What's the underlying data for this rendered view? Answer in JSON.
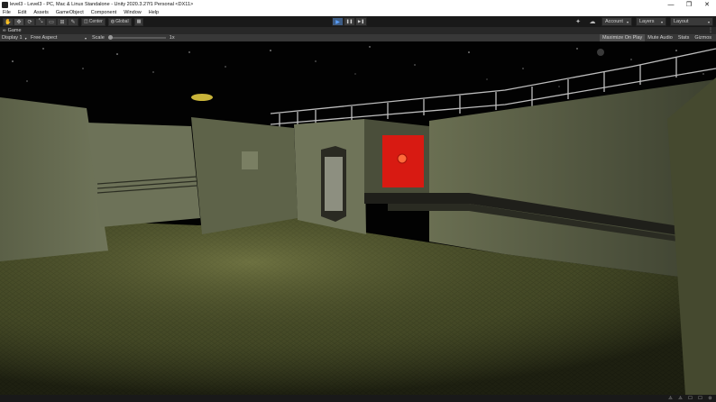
{
  "window": {
    "title": "level3 - Level3 - PC, Mac & Linux Standalone - Unity 2020.3.27f1 Personal <DX11>",
    "minimize": "—",
    "maximize": "❐",
    "close": "✕"
  },
  "menu": [
    "File",
    "Edit",
    "Assets",
    "GameObject",
    "Component",
    "Window",
    "Help"
  ],
  "toolbar": {
    "tools": [
      {
        "name": "hand-tool",
        "glyph": "✋"
      },
      {
        "name": "move-tool",
        "glyph": "✥"
      },
      {
        "name": "rotate-tool",
        "glyph": "⟳"
      },
      {
        "name": "scale-tool",
        "glyph": "⤡"
      },
      {
        "name": "rect-tool",
        "glyph": "▭"
      },
      {
        "name": "transform-tool",
        "glyph": "⊞"
      },
      {
        "name": "custom-tool",
        "glyph": "✎"
      }
    ],
    "pivot_label": "Center",
    "space_label": "Global",
    "snap_glyph": "▦",
    "play_glyph": "▶",
    "pause_glyph": "❚❚",
    "step_glyph": "▶❚",
    "collab_glyph": "✦",
    "cloud_glyph": "☁",
    "account_label": "Account",
    "layers_label": "Layers",
    "layout_label": "Layout",
    "caret": "▾"
  },
  "game_tab": {
    "label": "Game",
    "icon": "∞",
    "menu_glyph": "⋮"
  },
  "game_bar": {
    "display": "Display 1",
    "aspect": "Free Aspect",
    "scale_label": "Scale",
    "scale_value": "1x",
    "scale_fraction": 0.0,
    "maximize_on_play": "Maximize On Play",
    "mute_audio": "Mute Audio",
    "stats": "Stats",
    "gizmos": "Gizmos"
  },
  "status_icons": [
    "⚠",
    "⚠",
    "☐",
    "☐",
    "⊙"
  ],
  "colors": {
    "play_active": "#3d5c84",
    "safe_red": "#d81a12",
    "floor": "#4a4f2a",
    "wall": "#6b7052"
  }
}
